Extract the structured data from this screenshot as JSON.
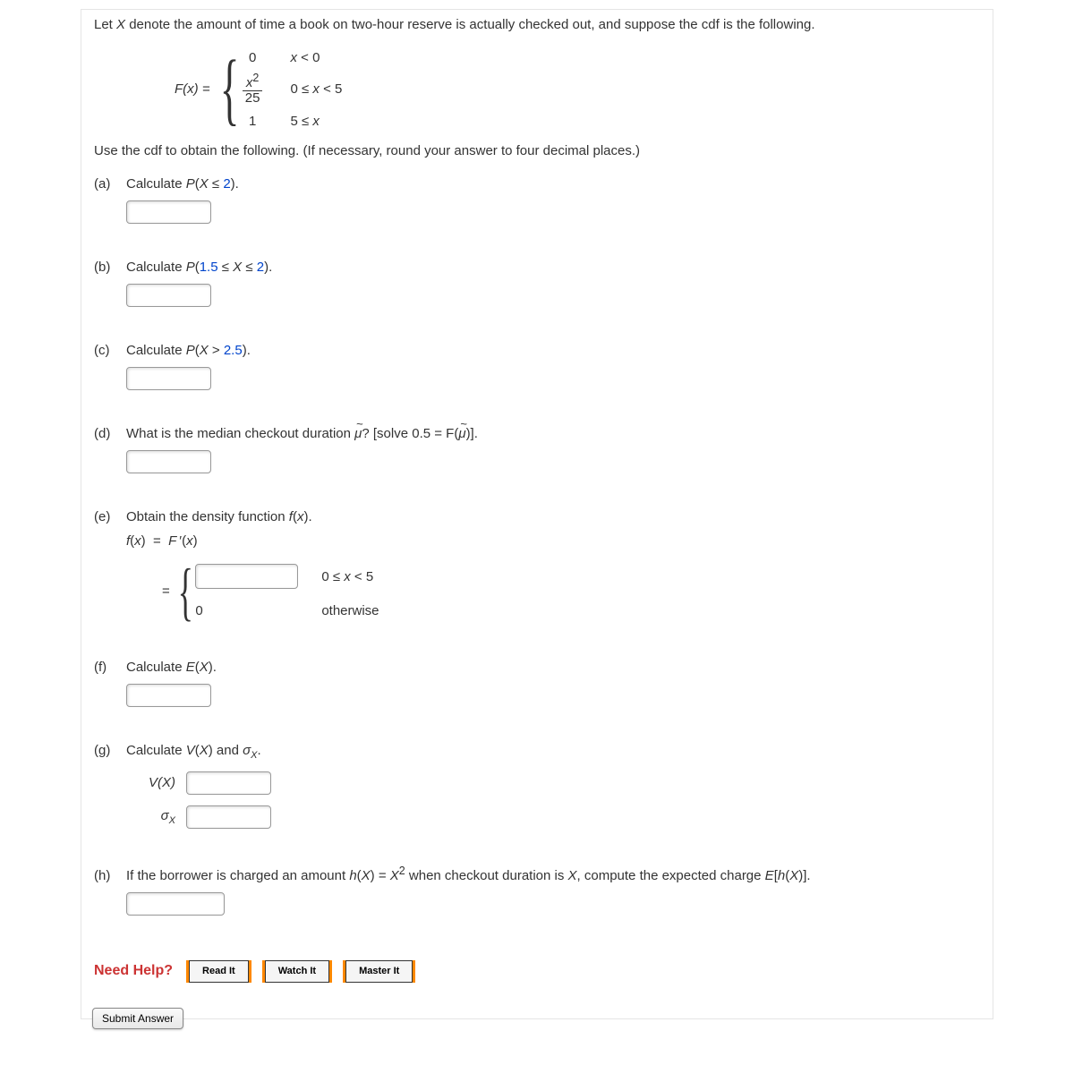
{
  "intro": "Let X denote the amount of time a book on two-hour reserve is actually checked out, and suppose the cdf is the following.",
  "cdf": {
    "lhs": "F(x) =",
    "cases": [
      {
        "value": "0",
        "condition": "x < 0"
      },
      {
        "value_frac": {
          "num": "x²",
          "den": "25"
        },
        "condition": "0 ≤ x < 5"
      },
      {
        "value": "1",
        "condition": "5 ≤ x"
      }
    ]
  },
  "instruction": "Use the cdf to obtain the following. (If necessary, round your answer to four decimal places.)",
  "parts": {
    "a": {
      "label": "(a)",
      "prompt_pre": "Calculate ",
      "prompt_math": "P(X ≤ 2).",
      "prompt_post": ""
    },
    "b": {
      "label": "(b)",
      "prompt_pre": "Calculate ",
      "prompt_math": "P(1.5 ≤ X ≤ 2).",
      "prompt_post": ""
    },
    "c": {
      "label": "(c)",
      "prompt_pre": "Calculate ",
      "prompt_math": "P(X > 2.5).",
      "prompt_post": ""
    },
    "d": {
      "label": "(d)",
      "prompt_text": "What is the median checkout duration ",
      "prompt_mu": "μ",
      "prompt_suffix": "? [solve ",
      "prompt_eq": "0.5 = F(",
      "prompt_mu2": "μ",
      "prompt_end": ")]."
    },
    "e": {
      "label": "(e)",
      "prompt": "Obtain the density function f(x).",
      "eq": "f(x)  =  F ′(x)",
      "inline_eq": "=",
      "case1_cond": "0 ≤ x < 5",
      "case2_val": "0",
      "case2_cond": "otherwise"
    },
    "f": {
      "label": "(f)",
      "prompt_pre": "Calculate ",
      "prompt_math": "E(X)."
    },
    "g": {
      "label": "(g)",
      "prompt_pre": "Calculate ",
      "prompt_math1": "V(X)",
      "prompt_and": " and ",
      "prompt_sigma": "σ",
      "prompt_sigma_sub": "X",
      "prompt_dot": ".",
      "vx_label": "V(X)",
      "sx_label": "σ",
      "sx_sub": "X"
    },
    "h": {
      "label": "(h)",
      "prompt": "If the borrower is charged an amount h(X) = X² when checkout duration is X, compute the expected charge E[h(X)]."
    }
  },
  "help": {
    "label": "Need Help?",
    "read": "Read It",
    "watch": "Watch It",
    "master": "Master It"
  },
  "submit": "Submit Answer"
}
